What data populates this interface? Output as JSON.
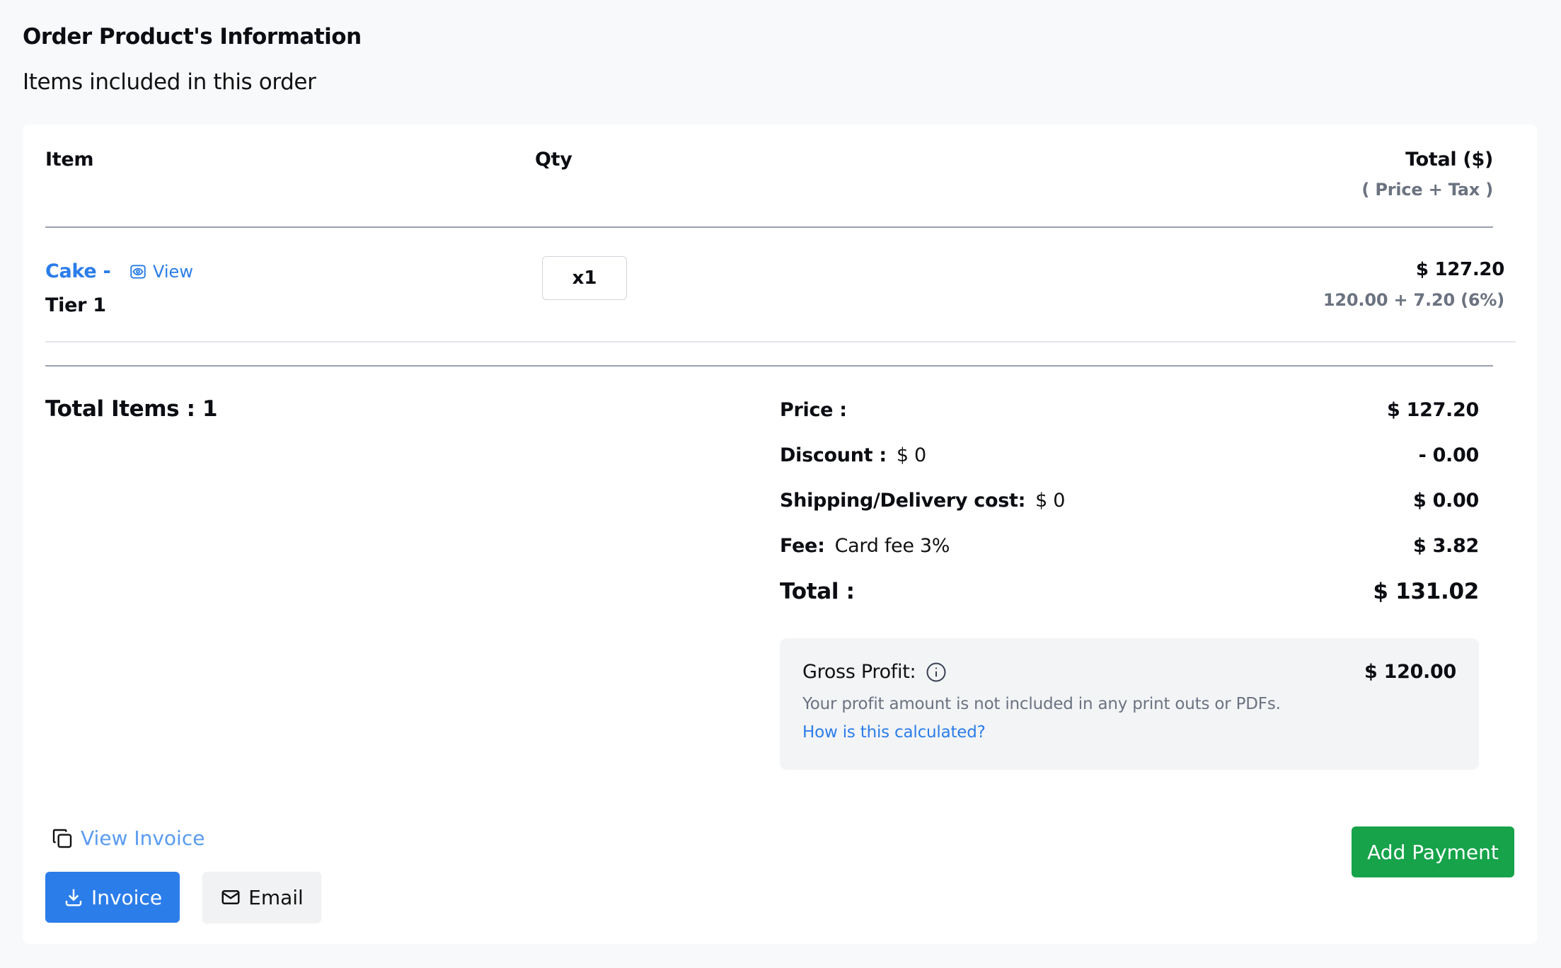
{
  "header": {
    "title": "Order Product's Information",
    "subtitle": "Items included in this order"
  },
  "table": {
    "columns": {
      "item": "Item",
      "qty": "Qty",
      "total": "Total ($)",
      "total_sub": "( Price + Tax )"
    },
    "rows": [
      {
        "name": "Cake -",
        "view_label": "View",
        "variant": "Tier 1",
        "qty": "x1",
        "total": "$ 127.20",
        "breakdown": "120.00 + 7.20 (6%)"
      }
    ]
  },
  "summary": {
    "total_items": "Total Items : 1",
    "price_label": "Price :",
    "price_value": "$ 127.20",
    "discount_label": "Discount :",
    "discount_detail": "$ 0",
    "discount_value": "- 0.00",
    "shipping_label": "Shipping/Delivery cost:",
    "shipping_detail": "$ 0",
    "shipping_value": "$ 0.00",
    "fee_label": "Fee:",
    "fee_detail": "Card fee 3%",
    "fee_value": "$ 3.82",
    "total_label": "Total :",
    "total_value": "$ 131.02"
  },
  "profit": {
    "label": "Gross Profit:",
    "value": "$ 120.00",
    "note": "Your profit amount is not included in any print outs or PDFs.",
    "link": "How is this calculated?"
  },
  "actions": {
    "view_invoice": "View Invoice",
    "invoice": "Invoice",
    "email": "Email",
    "add_payment": "Add Payment"
  },
  "colors": {
    "accent_blue": "#2b7de9",
    "success_green": "#16a34a",
    "muted_text": "#6b7280"
  },
  "icons": [
    "eye-view-icon",
    "info-icon",
    "copy-icon",
    "download-icon",
    "mail-icon"
  ]
}
